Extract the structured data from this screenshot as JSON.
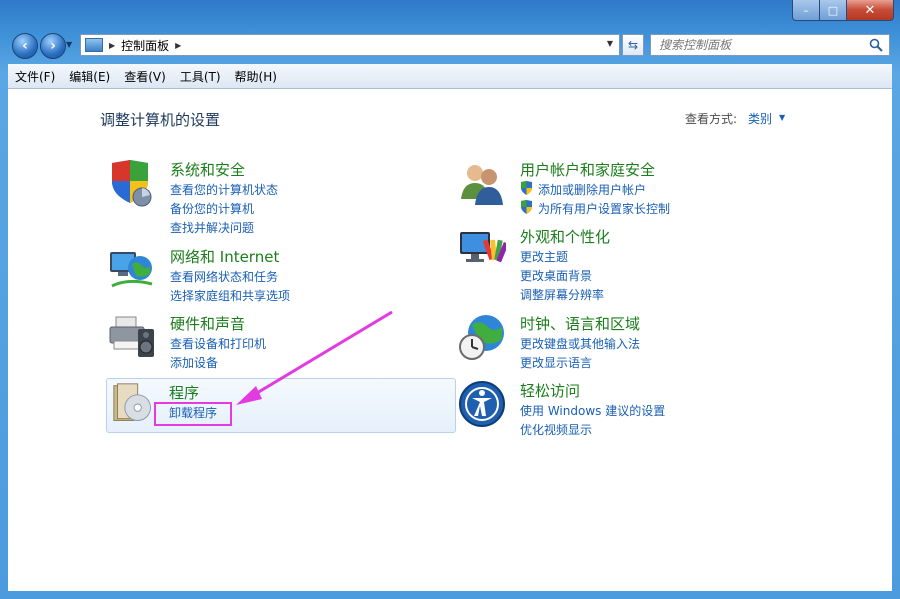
{
  "window": {
    "minimize": "–",
    "maximize": "□",
    "close": "✕"
  },
  "navbar": {
    "address_path": "控制面板",
    "search_placeholder": "搜索控制面板"
  },
  "menu": [
    "文件(F)",
    "编辑(E)",
    "查看(V)",
    "工具(T)",
    "帮助(H)"
  ],
  "content": {
    "title": "调整计算机的设置",
    "view_by_label": "查看方式:",
    "view_by_value": "类别"
  },
  "categories": [
    {
      "title": "系统和安全",
      "icon": "shield-computer-icon",
      "links": [
        "查看您的计算机状态",
        "备份您的计算机",
        "查找并解决问题"
      ]
    },
    {
      "title": "网络和 Internet",
      "icon": "network-globe-icon",
      "links": [
        "查看网络状态和任务",
        "选择家庭组和共享选项"
      ]
    },
    {
      "title": "硬件和声音",
      "icon": "printer-speaker-icon",
      "links": [
        "查看设备和打印机",
        "添加设备"
      ]
    },
    {
      "title": "程序",
      "icon": "programs-disc-icon",
      "links": [
        "卸载程序"
      ]
    },
    {
      "title": "用户帐户和家庭安全",
      "icon": "users-icon",
      "links": [
        "添加或删除用户帐户",
        "为所有用户设置家长控制"
      ]
    },
    {
      "title": "外观和个性化",
      "icon": "monitor-palette-icon",
      "links": [
        "更改主题",
        "更改桌面背景",
        "调整屏幕分辨率"
      ]
    },
    {
      "title": "时钟、语言和区域",
      "icon": "globe-clock-icon",
      "links": [
        "更改键盘或其他输入法",
        "更改显示语言"
      ]
    },
    {
      "title": "轻松访问",
      "icon": "ease-of-access-icon",
      "links": [
        "使用 Windows 建议的设置",
        "优化视频显示"
      ]
    }
  ],
  "colors": {
    "category_title": "#1b7d1b",
    "link": "#1a5fb4",
    "annotation": "#e23be0"
  }
}
